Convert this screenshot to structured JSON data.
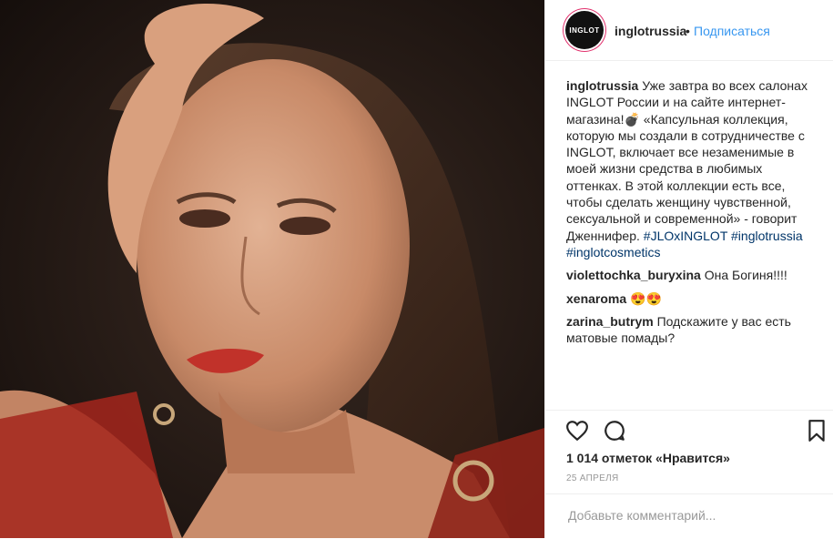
{
  "post": {
    "username": "inglotrussia",
    "avatar_text": "INGLOT",
    "separator": "•",
    "follow_label": "Подписаться",
    "caption": {
      "username": "inglotrussia",
      "text": "Уже завтра во всех салонах INGLOT России и на сайте интернет-магазина!💣 «Капсульная коллекция, которую мы создали в сотрудничестве с INGLOT, включает все незаменимые в моей жизни средства в любимых оттенках. В этой коллекции есть все, чтобы сделать женщину чувственной, сексуальной и современной» - говорит Дженнифер.",
      "hashtags": [
        "#JLOxINGLOT",
        "#inglotrussia",
        "#inglotcosmetics"
      ]
    },
    "comments": [
      {
        "username": "violettochka_buryxina",
        "text": "Она Богиня!!!!"
      },
      {
        "username": "xenaroma",
        "text": "😍😍"
      },
      {
        "username": "zarina_butrym",
        "text": "Подскажите у вас есть матовые помады?"
      }
    ],
    "likes": "1 014 отметок «Нравится»",
    "date": "25 АПРЕЛЯ",
    "comment_placeholder": "Добавьте комментарий...",
    "icons": [
      "heart-icon",
      "comment-icon",
      "bookmark-icon"
    ],
    "colors": {
      "link": "#3897f0",
      "hashtag": "#003569",
      "text": "#262626",
      "muted": "#999999"
    }
  }
}
